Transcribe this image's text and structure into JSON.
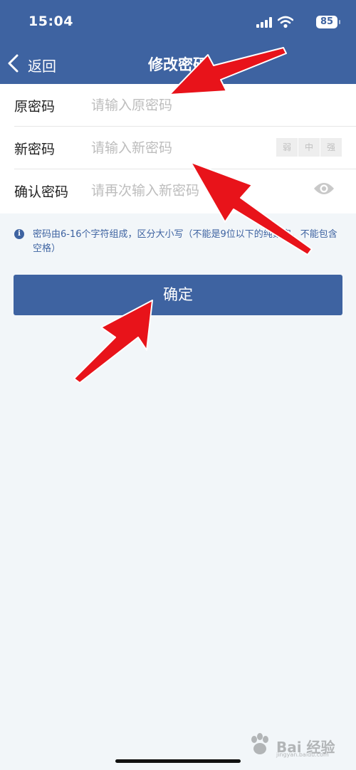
{
  "status_bar": {
    "time": "15:04",
    "battery": "85",
    "icons": [
      "signal-icon",
      "wifi-icon",
      "battery-icon"
    ]
  },
  "nav": {
    "back_label": "返回",
    "back_icon": "chevron-left-icon",
    "title": "修改密码"
  },
  "form": {
    "rows": [
      {
        "label": "原密码",
        "placeholder": "请输入原密码",
        "value": ""
      },
      {
        "label": "新密码",
        "placeholder": "请输入新密码",
        "value": ""
      },
      {
        "label": "确认密码",
        "placeholder": "请再次输入新密码",
        "value": ""
      }
    ],
    "strength_levels": [
      "弱",
      "中",
      "强"
    ],
    "reveal_icon": "eye-icon"
  },
  "hint": {
    "icon": "info-icon",
    "text": "密码由6-16个字符组成，区分大小写（不能是9位以下的纯数字，不能包含空格）"
  },
  "confirm_label": "确定",
  "watermark": {
    "text": "Bai 经验",
    "domain": "jingyan.baidu.com"
  },
  "colors": {
    "brand_blue": "#3e63a1",
    "background": "#f2f6f9",
    "annotation_red": "#e8131a"
  }
}
